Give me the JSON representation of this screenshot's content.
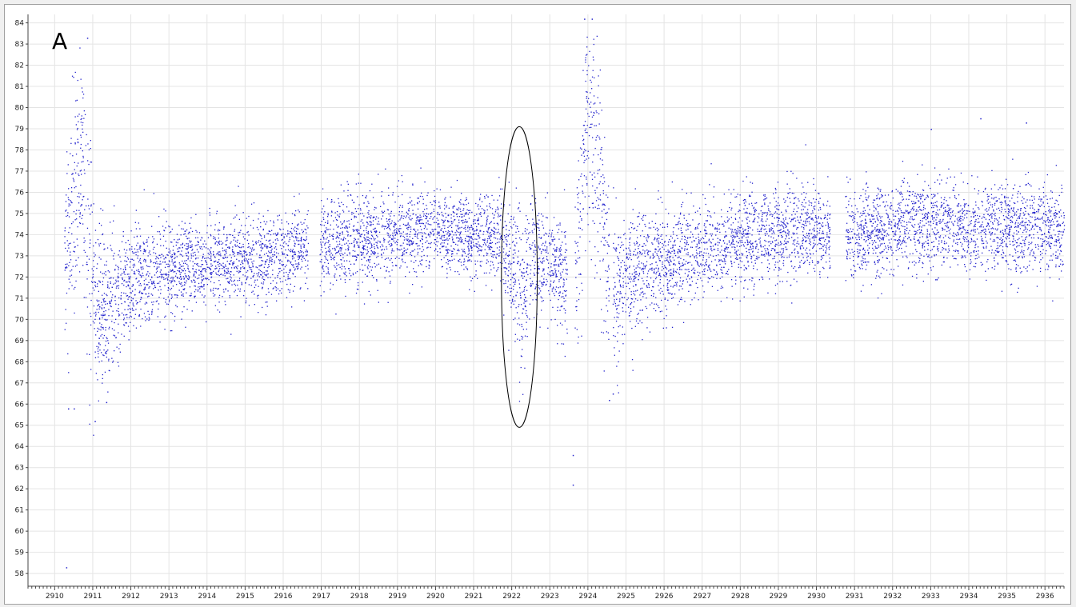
{
  "panel_label": "A",
  "colors": {
    "points": "#2222cc",
    "grid": "#e4e4e4",
    "axis": "#444444",
    "annotation": "#000000"
  },
  "chart_data": {
    "type": "scatter",
    "title": "",
    "xlabel": "",
    "ylabel": "",
    "xlim": [
      2909.3,
      2936.5
    ],
    "ylim": [
      57.4,
      84.4
    ],
    "grid": true,
    "legend": "none",
    "x_ticks": [
      2910,
      2911,
      2912,
      2913,
      2914,
      2915,
      2916,
      2917,
      2918,
      2919,
      2920,
      2921,
      2922,
      2923,
      2924,
      2925,
      2926,
      2927,
      2928,
      2929,
      2930,
      2931,
      2932,
      2933,
      2934,
      2935,
      2936
    ],
    "y_ticks": [
      58,
      59,
      60,
      61,
      62,
      63,
      64,
      65,
      66,
      67,
      68,
      69,
      70,
      71,
      72,
      73,
      74,
      75,
      76,
      77,
      78,
      79,
      80,
      81,
      82,
      83,
      84
    ],
    "density_profile": {
      "description_points": [
        [
          2910.25,
          73.0,
          3.0
        ],
        [
          2910.5,
          75.0,
          3.2
        ],
        [
          2910.7,
          77.5,
          2.6
        ],
        [
          2910.85,
          74.0,
          3.5
        ],
        [
          2911.0,
          71.5,
          2.4
        ],
        [
          2911.3,
          70.5,
          1.8
        ],
        [
          2911.6,
          71.0,
          1.5
        ],
        [
          2912.0,
          71.8,
          1.3
        ],
        [
          2913.0,
          72.3,
          1.1
        ],
        [
          2914.0,
          72.7,
          1.0
        ],
        [
          2915.0,
          72.8,
          1.0
        ],
        [
          2916.0,
          73.0,
          1.0
        ],
        [
          2916.7,
          73.2,
          1.0
        ],
        [
          2916.95,
          73.5,
          1.1
        ],
        [
          2918.0,
          73.8,
          1.1
        ],
        [
          2919.0,
          74.0,
          1.0
        ],
        [
          2920.0,
          74.1,
          1.0
        ],
        [
          2921.0,
          74.0,
          0.9
        ],
        [
          2921.7,
          73.8,
          1.0
        ],
        [
          2922.0,
          72.5,
          1.6
        ],
        [
          2922.2,
          71.0,
          2.2
        ],
        [
          2922.5,
          73.0,
          1.4
        ],
        [
          2923.0,
          72.8,
          1.1
        ],
        [
          2923.4,
          72.0,
          1.5
        ],
        [
          2923.75,
          74.0,
          2.5
        ],
        [
          2923.95,
          79.5,
          2.4
        ],
        [
          2924.2,
          78.0,
          3.0
        ],
        [
          2924.45,
          73.5,
          2.8
        ],
        [
          2924.7,
          71.5,
          2.0
        ],
        [
          2925.0,
          72.0,
          1.5
        ],
        [
          2926.0,
          72.7,
          1.2
        ],
        [
          2927.0,
          73.3,
          1.1
        ],
        [
          2928.0,
          73.8,
          1.1
        ],
        [
          2929.0,
          74.0,
          1.1
        ],
        [
          2930.0,
          74.1,
          1.0
        ],
        [
          2930.45,
          74.0,
          1.0
        ],
        [
          2930.8,
          73.8,
          1.0
        ],
        [
          2931.0,
          74.0,
          1.1
        ],
        [
          2932.0,
          74.4,
          1.1
        ],
        [
          2933.0,
          74.5,
          1.1
        ],
        [
          2934.0,
          74.4,
          1.0
        ],
        [
          2935.0,
          74.3,
          1.0
        ],
        [
          2936.0,
          74.2,
          1.0
        ],
        [
          2936.5,
          74.0,
          1.0
        ]
      ],
      "gaps": [
        [
          2916.65,
          2916.95
        ],
        [
          2923.45,
          2923.65
        ],
        [
          2924.55,
          2924.65
        ],
        [
          2930.35,
          2930.75
        ]
      ]
    },
    "outliers": [
      {
        "x": 2910.3,
        "y": 58.3
      },
      {
        "x": 2910.35,
        "y": 65.8
      },
      {
        "x": 2910.5,
        "y": 65.8
      },
      {
        "x": 2911.05,
        "y": 65.2
      },
      {
        "x": 2911.35,
        "y": 66.1
      },
      {
        "x": 2923.6,
        "y": 63.6
      },
      {
        "x": 2923.6,
        "y": 62.2
      },
      {
        "x": 2924.55,
        "y": 66.2
      },
      {
        "x": 2924.65,
        "y": 66.5
      },
      {
        "x": 2910.85,
        "y": 83.3
      },
      {
        "x": 2923.9,
        "y": 84.2
      },
      {
        "x": 2924.1,
        "y": 84.2
      },
      {
        "x": 2934.3,
        "y": 79.5
      },
      {
        "x": 2935.5,
        "y": 79.3
      },
      {
        "x": 2933.0,
        "y": 79.0
      }
    ],
    "annotations": [
      {
        "type": "ellipse",
        "cx": 2922.2,
        "cy": 72.0,
        "rx": 0.47,
        "ry": 7.1
      }
    ]
  }
}
